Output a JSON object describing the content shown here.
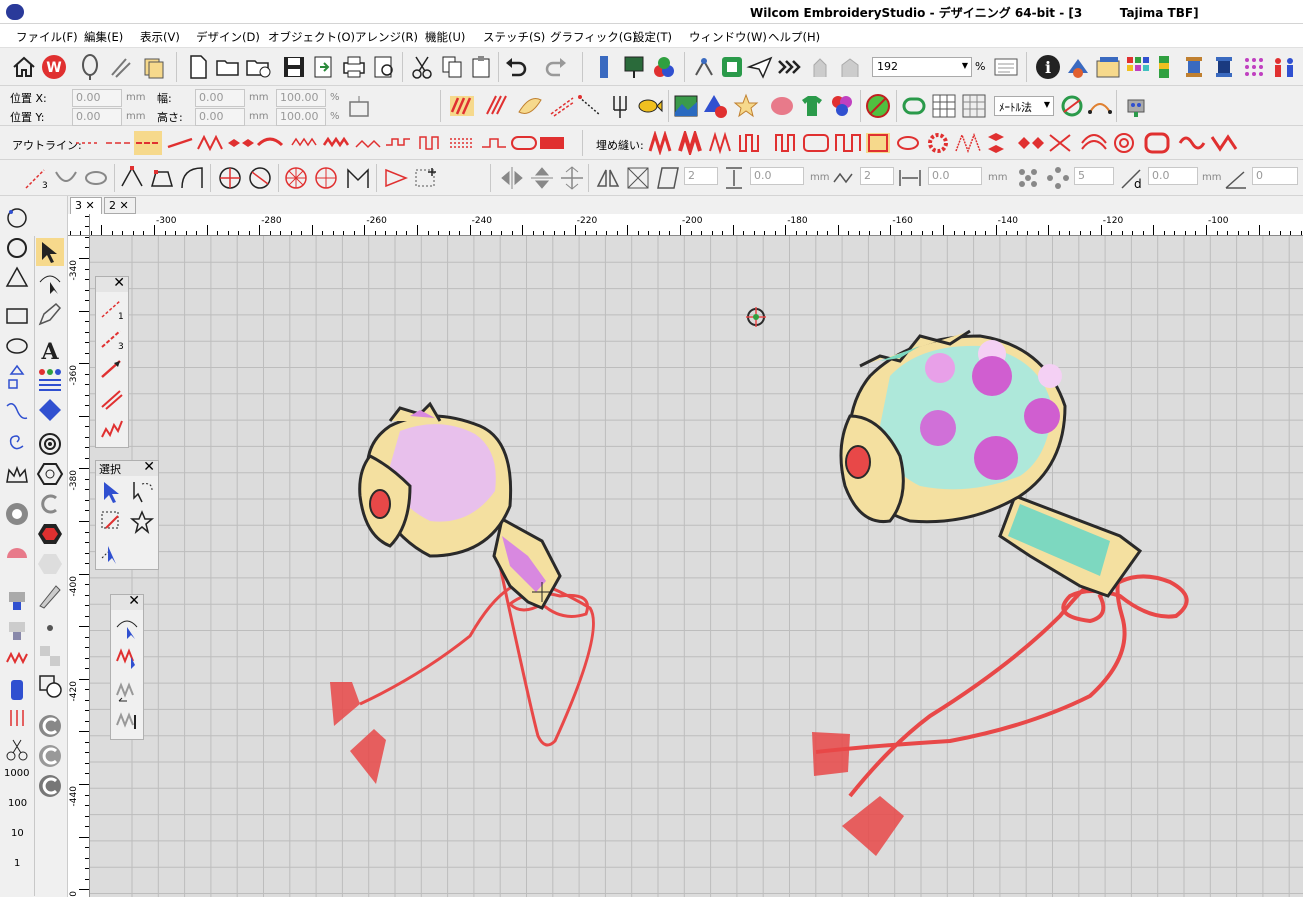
{
  "title": "Wilcom EmbroideryStudio - デザイニング 64-bit - [3         Tajima TBF]",
  "menu": [
    "ファイル(F)",
    "編集(E)",
    "表示(V)",
    "デザイン(D)",
    "オブジェクト(O)",
    "アレンジ(R)",
    "機能(U)",
    "ステッチ(S)",
    "グラフィック(G)",
    "設定(T)",
    "ウィンドウ(W)",
    "ヘルプ(H)"
  ],
  "zoom": {
    "value": "192",
    "unit": "%"
  },
  "position": {
    "x_label": "位置 X:",
    "y_label": "位置 Y:",
    "x_value": "0.00",
    "y_value": "0.00",
    "width_label": "幅:",
    "height_label": "高さ:",
    "width_value": "0.00",
    "height_value": "0.00",
    "width_pct": "100.00",
    "height_pct": "100.00",
    "unit_mm": "mm",
    "unit_pct": "%"
  },
  "method_select": "ﾒｰﾄﾙ法",
  "outline_label": "アウトライン:",
  "fill_label": "埋め縫い:",
  "tb4": {
    "v1": "2",
    "v2": "0.0",
    "u2": "mm",
    "v3": "2",
    "v4": "0.0",
    "u4": "mm",
    "v5": "5",
    "v6": "0.0",
    "u6": "mm",
    "v7": "0"
  },
  "tabs": [
    {
      "label": "3",
      "close": "✕"
    },
    {
      "label": "2",
      "close": "✕"
    }
  ],
  "hruler": [
    "-300",
    "-280",
    "-260",
    "-240",
    "-220",
    "-200",
    "-180",
    "-160",
    "-140",
    "-120",
    "-100"
  ],
  "vruler": [
    "-340",
    "-360",
    "-380",
    "-400",
    "-420",
    "-440",
    "-460"
  ],
  "left_numbers": [
    "1000",
    "100",
    "10",
    "1"
  ],
  "select_panel_title": "選択",
  "panel_close": "✕",
  "colors": {
    "thread_red": "#e84848",
    "pink": "#e0b0e8",
    "mint": "#7dd8c0",
    "tan": "#e8c890",
    "outline": "#2a2a2a"
  }
}
